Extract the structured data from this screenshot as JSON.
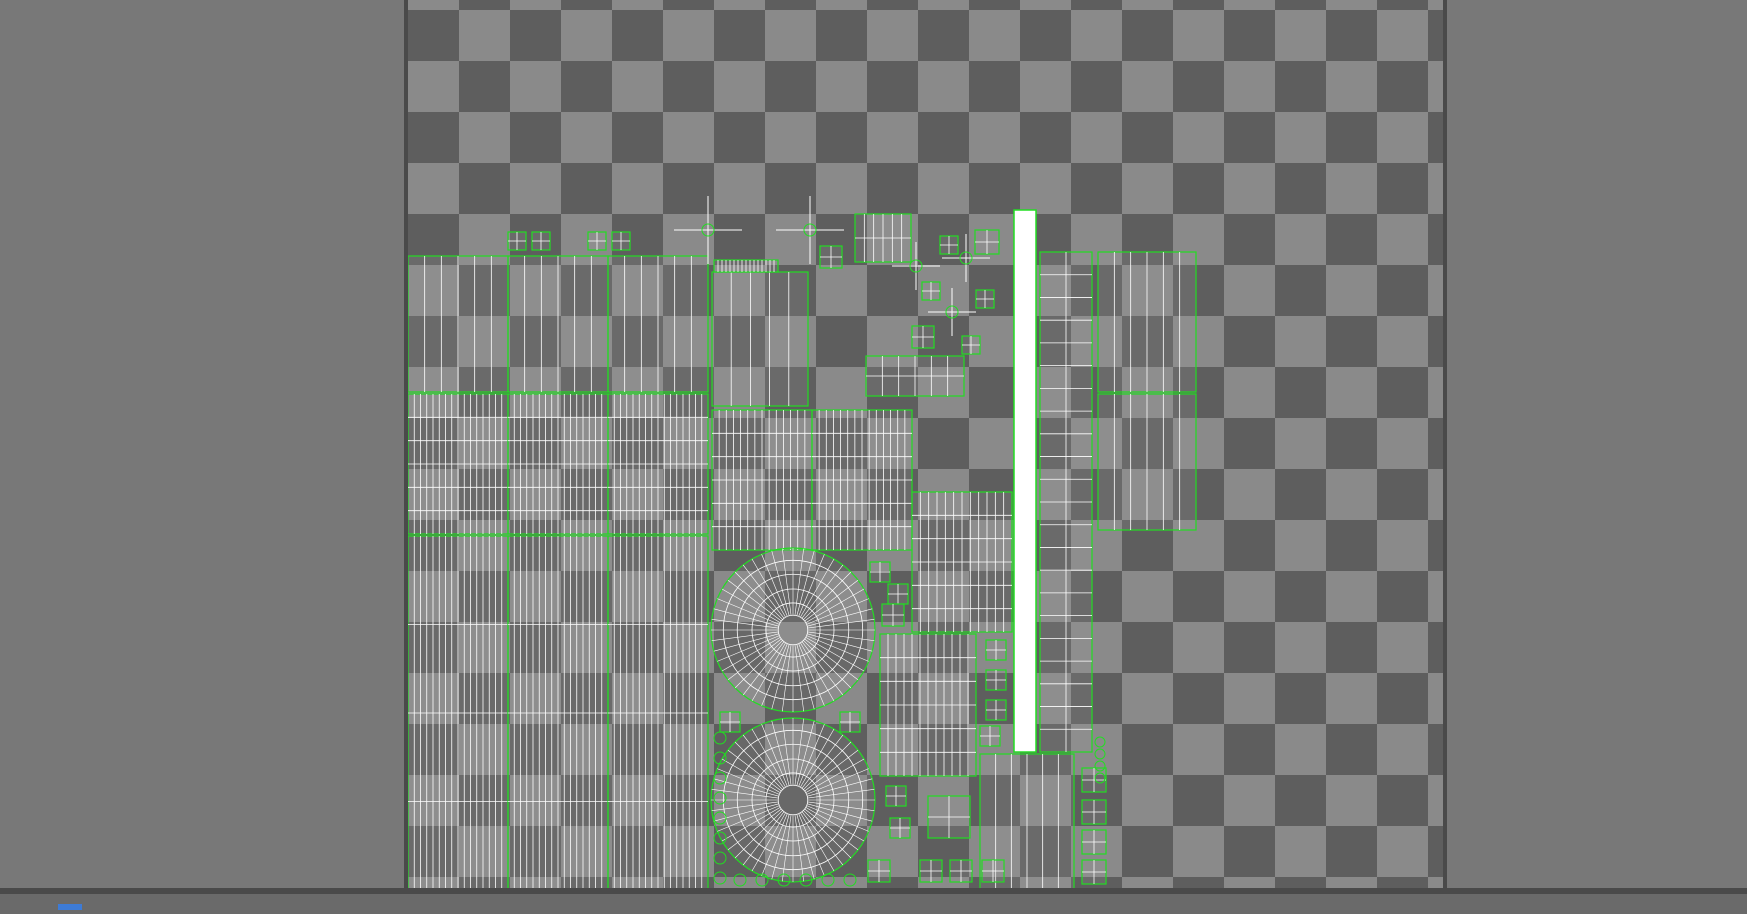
{
  "app": {
    "view": "UV Editor"
  },
  "colors": {
    "panel": "#787878",
    "checker_light": "#8a8a8a",
    "checker_dark": "#5e5e5e",
    "uv_edge": "#ffffff",
    "uv_border": "#22dd22"
  },
  "icons": [
    "status-icon"
  ]
}
